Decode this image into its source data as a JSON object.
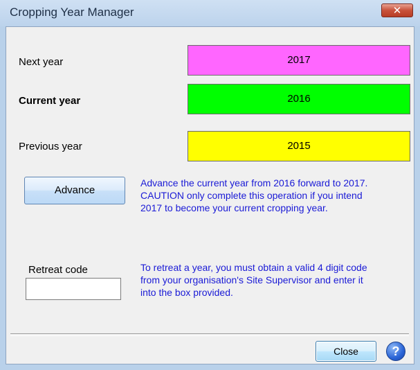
{
  "window": {
    "title": "Cropping Year Manager",
    "close_icon": "✕"
  },
  "years": {
    "next": {
      "label": "Next year",
      "value": "2017",
      "color": "#ff66ff"
    },
    "current": {
      "label": "Current year",
      "value": "2016",
      "color": "#00ff00"
    },
    "previous": {
      "label": "Previous year",
      "value": "2015",
      "color": "#ffff00"
    }
  },
  "advance": {
    "button_label": "Advance",
    "info_line1": "Advance the current year from 2016 forward to 2017.",
    "info_line2": "CAUTION only complete this operation if you intend",
    "info_line3": "2017 to become your current cropping year."
  },
  "retreat": {
    "label": "Retreat code",
    "input_value": "",
    "info_line1": "To retreat a year, you must obtain a valid 4 digit code",
    "info_line2": "from your organisation's Site Supervisor and enter it",
    "info_line3": "into the box provided."
  },
  "footer": {
    "close_label": "Close",
    "help_icon": "?"
  }
}
